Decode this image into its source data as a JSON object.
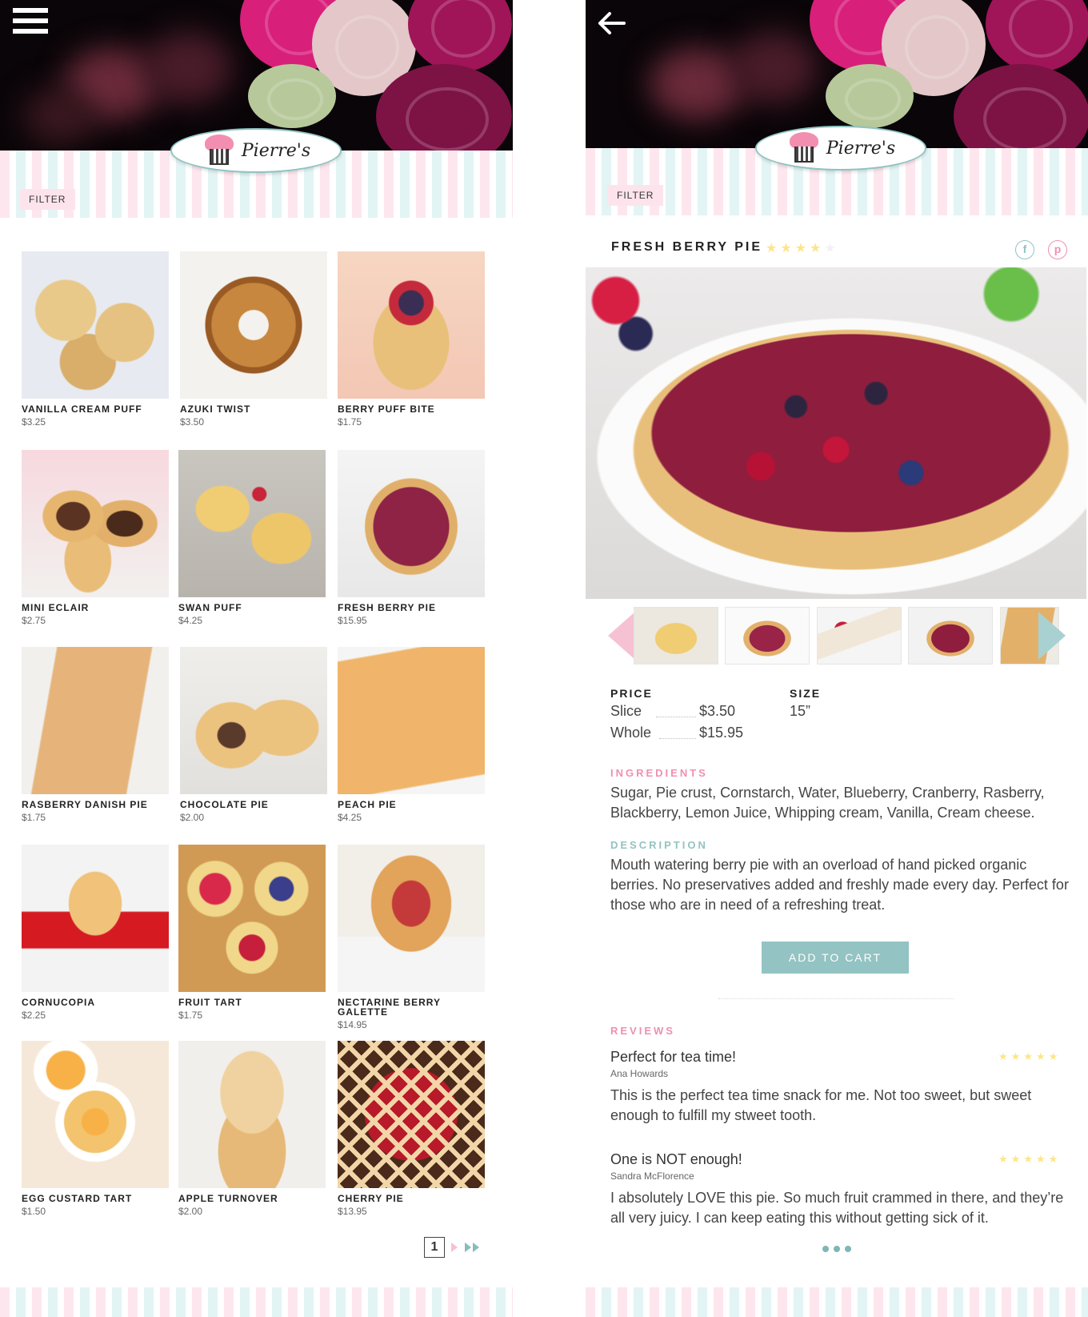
{
  "brand": {
    "name": "Pierre's"
  },
  "list_screen": {
    "filter_label": "FILTER",
    "products": [
      {
        "name": "VANILLA CREAM PUFF",
        "price": "$3.25"
      },
      {
        "name": "AZUKI TWIST",
        "price": "$3.50"
      },
      {
        "name": "BERRY PUFF BITE",
        "price": "$1.75"
      },
      {
        "name": "MINI ECLAIR",
        "price": "$2.75"
      },
      {
        "name": "SWAN PUFF",
        "price": "$4.25"
      },
      {
        "name": "FRESH BERRY PIE",
        "price": "$15.95"
      },
      {
        "name": "RASBERRY DANISH PIE",
        "price": "$1.75"
      },
      {
        "name": "CHOCOLATE PIE",
        "price": "$2.00"
      },
      {
        "name": "PEACH PIE",
        "price": "$4.25"
      },
      {
        "name": "CORNUCOPIA",
        "price": "$2.25"
      },
      {
        "name": "FRUIT TART",
        "price": "$1.75"
      },
      {
        "name": "NECTARINE BERRY GALETTE",
        "price": "$14.95"
      },
      {
        "name": "EGG CUSTARD TART",
        "price": "$1.50"
      },
      {
        "name": "APPLE TURNOVER",
        "price": "$2.00"
      },
      {
        "name": "CHERRY PIE",
        "price": "$13.95"
      }
    ],
    "pagination": {
      "current_page": "1"
    }
  },
  "detail_screen": {
    "filter_label": "FILTER",
    "product_title": "FRESH BERRY PIE",
    "rating": 4,
    "rating_max": 5,
    "price_label": "PRICE",
    "prices": [
      {
        "label": "Slice",
        "value": "$3.50"
      },
      {
        "label": "Whole",
        "value": "$15.95"
      }
    ],
    "size_label": "SIZE",
    "size_value": "15”",
    "ingredients_label": "INGREDIENTS",
    "ingredients_text": "Sugar, Pie crust, Cornstarch, Water, Blueberry, Cranberry, Rasberry, Blackberry, Lemon Juice, Whipping cream, Vanilla, Cream cheese.",
    "description_label": "DESCRIPTION",
    "description_text": "Mouth watering berry pie with an overload of hand picked organic berries. No preservatives added and freshly made every day. Perfect for those who are in need of a refreshing treat.",
    "add_to_cart_label": "ADD TO CART",
    "reviews_label": "REVIEWS",
    "reviews": [
      {
        "title": "Perfect for tea time!",
        "author": "Ana Howards",
        "rating": 5,
        "body": "This is the perfect tea time snack for me. Not too sweet, but sweet enough to fulfill my stweet tooth."
      },
      {
        "title": "One is NOT enough!",
        "author": "Sandra McFlorence",
        "rating": 5,
        "body": "I absolutely LOVE this pie. So much fruit crammed in there, and they’re all very juicy. I can keep eating this without getting sick of it."
      }
    ]
  },
  "colors": {
    "accent_pink": "#f08fb0",
    "accent_teal": "#93c3c2",
    "star_yellow": "#fde58a",
    "star_empty": "#f2f2f2"
  },
  "icons": {
    "menu": "menu-icon",
    "back": "back-arrow-icon",
    "facebook": "facebook-icon",
    "pinterest": "pinterest-icon",
    "carousel_prev": "triangle-left-icon",
    "carousel_next": "triangle-right-icon",
    "next_page": "chevron-right-icon",
    "last_page": "double-chevron-right-icon"
  }
}
